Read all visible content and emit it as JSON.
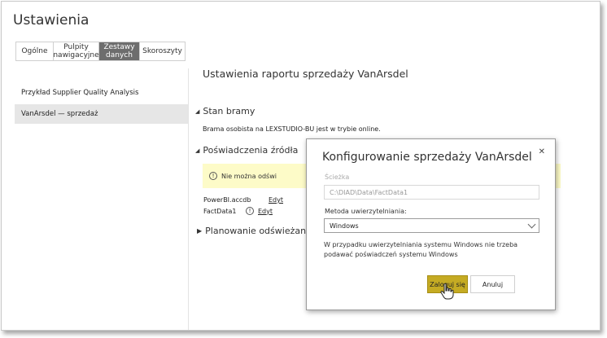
{
  "page": {
    "title": "Ustawienia"
  },
  "tabs": [
    {
      "label": "Ogólne",
      "active": false
    },
    {
      "label": "Pulpity nawigacyjne",
      "active": false
    },
    {
      "label": "Zestawy danych",
      "active": true
    },
    {
      "label": "Skoroszyty",
      "active": false
    }
  ],
  "left_nav": [
    {
      "label": "Przykład Supplier Quality Analysis",
      "active": false
    },
    {
      "label": "VanArsdel — sprzedaż",
      "active": true
    }
  ],
  "report": {
    "title": "Ustawienia raportu sprzedaży VanArsdel",
    "gateway_section": "Stan bramy",
    "gateway_text": "Brama osobista na LEXSTUDIO-BU jest w trybie online.",
    "credentials_section": "Poświadczenia źródła",
    "warning_text": "Nie można odświ",
    "data_sources": [
      {
        "name": "PowerBI.accdb",
        "edit": "Edyt"
      },
      {
        "name": "FactData1",
        "edit": "Edyt"
      }
    ],
    "schedule_section": "Planowanie odświeżania"
  },
  "dialog": {
    "title": "Konfigurowanie sprzedaży VanArsdel",
    "path_label": "Ścieżka",
    "path_value": "C:\\DIAD\\Data\\FactData1",
    "auth_label": "Metoda uwierzytelniania:",
    "auth_value": "Windows",
    "help_text": "W przypadku uwierzytelniania systemu Windows nie trzeba podawać poświadczeń systemu Windows",
    "login_label": "Zaloguj się",
    "cancel_label": "Anuluj"
  },
  "colors": {
    "active_tab": "#6d6d6d",
    "primary_button": "#c5ab23",
    "warning_bg": "#fdfbc8",
    "nav_active": "#e6e6e6"
  }
}
